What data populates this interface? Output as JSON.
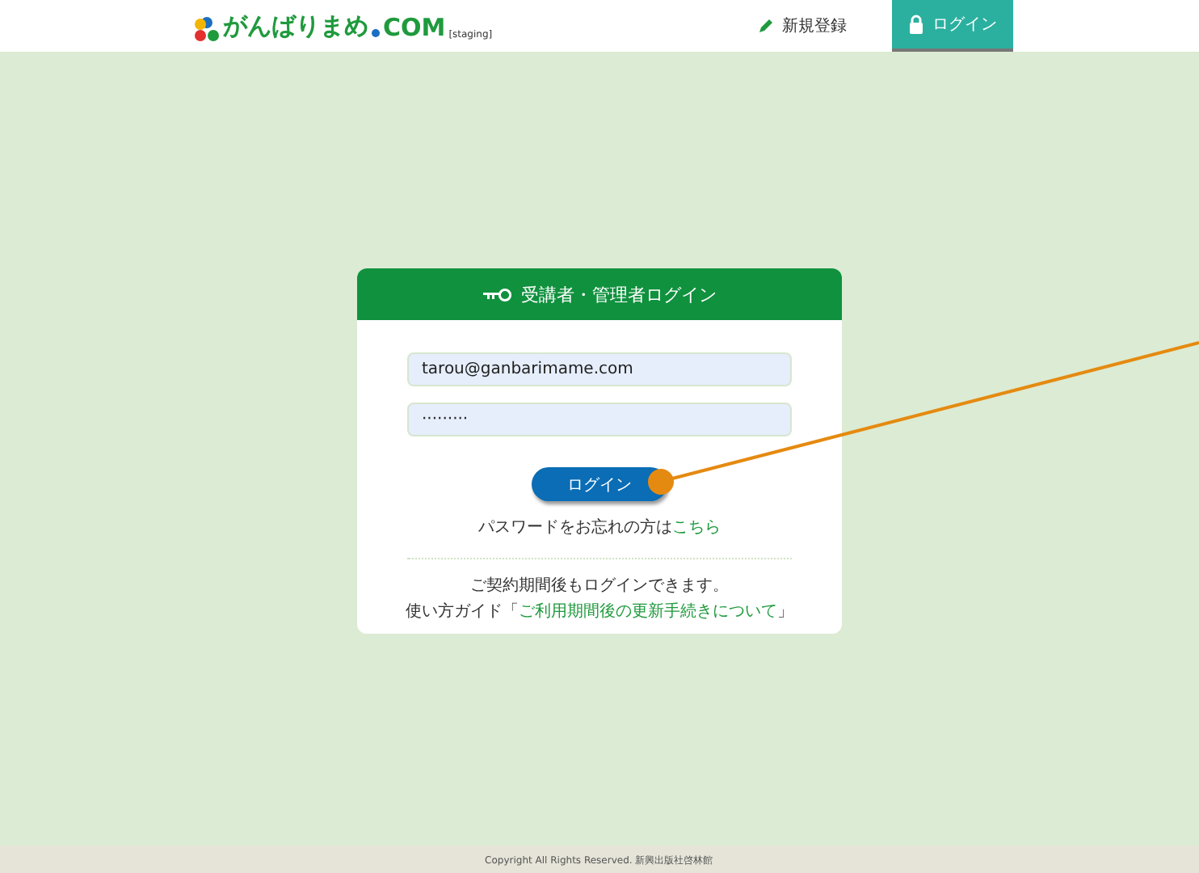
{
  "header": {
    "logo": "がんばりまめ",
    "logo_dot": "COM",
    "env": "[staging]",
    "nav": [
      {
        "label": "新規登録",
        "kind": "pencil",
        "selected": false
      },
      {
        "label": "ログイン",
        "kind": "lock",
        "selected": true
      }
    ]
  },
  "login_card": {
    "title": "受講者・管理者ログイン",
    "email": "tarou@ganbarimame.com",
    "password": "·········",
    "button": "ログイン",
    "forgot_text": "パスワードをお忘れの方は",
    "forgot_link": "こちら",
    "note": "ご契約期間後もログインできます。",
    "guide_text": "使い方ガイド「",
    "guide_link": "ご利用期間後の更新手続きについて",
    "guide_end": "」"
  },
  "footer": "Copyright All Rights Reserved. 新興出版社啓林館"
}
